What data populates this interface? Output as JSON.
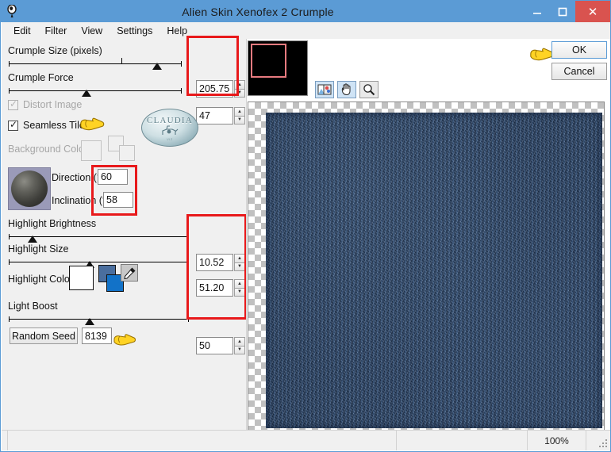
{
  "window": {
    "title": "Alien Skin Xenofex 2 Crumple",
    "app_icon": "brush-icon",
    "minimize_label": "–",
    "maximize_label": "▢",
    "close_label": "✕"
  },
  "menubar": {
    "items": [
      {
        "label": "Edit"
      },
      {
        "label": "Filter"
      },
      {
        "label": "View"
      },
      {
        "label": "Settings"
      },
      {
        "label": "Help"
      }
    ]
  },
  "controls": {
    "crumple_size": {
      "label": "Crumple Size (pixels)",
      "value": "205.75",
      "slider_percent": 86
    },
    "crumple_force": {
      "label": "Crumple Force",
      "value": "47",
      "slider_percent": 45
    },
    "distort_image": {
      "label": "Distort Image",
      "checked": true,
      "enabled": false,
      "check_glyph": "✓"
    },
    "seamless_tile": {
      "label": "Seamless Tile",
      "checked": true,
      "enabled": true,
      "check_glyph": "✓"
    },
    "background_color": {
      "label": "Background Color",
      "enabled": false
    },
    "direction": {
      "label": "Direction (°)",
      "value": "60"
    },
    "inclination": {
      "label": "Inclination (°)",
      "value": "58"
    },
    "highlight_brightness": {
      "label": "Highlight Brightness",
      "value": "10.52",
      "slider_percent": 13
    },
    "highlight_size": {
      "label": "Highlight Size",
      "value": "51.20",
      "slider_percent": 45
    },
    "highlight_color": {
      "label": "Highlight Color",
      "swatch_primary": "#ffffff",
      "swatch_secondary": "#4a6e9e",
      "swatch_tertiary": "#1272c8",
      "eyedropper_icon": "eyedropper-icon"
    },
    "light_boost": {
      "label": "Light Boost",
      "value": "50",
      "slider_percent": 45
    },
    "random_seed": {
      "button_label": "Random Seed",
      "value": "8139"
    }
  },
  "preview_panel": {
    "navigator_icon": "navigator-thumbnail",
    "tools": [
      {
        "name": "before-after-icon",
        "active": true
      },
      {
        "name": "pan-hand-icon",
        "active": true
      },
      {
        "name": "zoom-magnifier-icon",
        "active": false
      }
    ]
  },
  "actions": {
    "ok_label": "OK",
    "cancel_label": "Cancel"
  },
  "statusbar": {
    "left_text": "",
    "middle_text": "",
    "zoom_level": "100%"
  },
  "watermark": {
    "text": "CLAUDIA",
    "subtext": "VIZ"
  },
  "annotations": {
    "hand_icon": "pointing-hand-icon",
    "highlight_color": "#e8191b"
  }
}
